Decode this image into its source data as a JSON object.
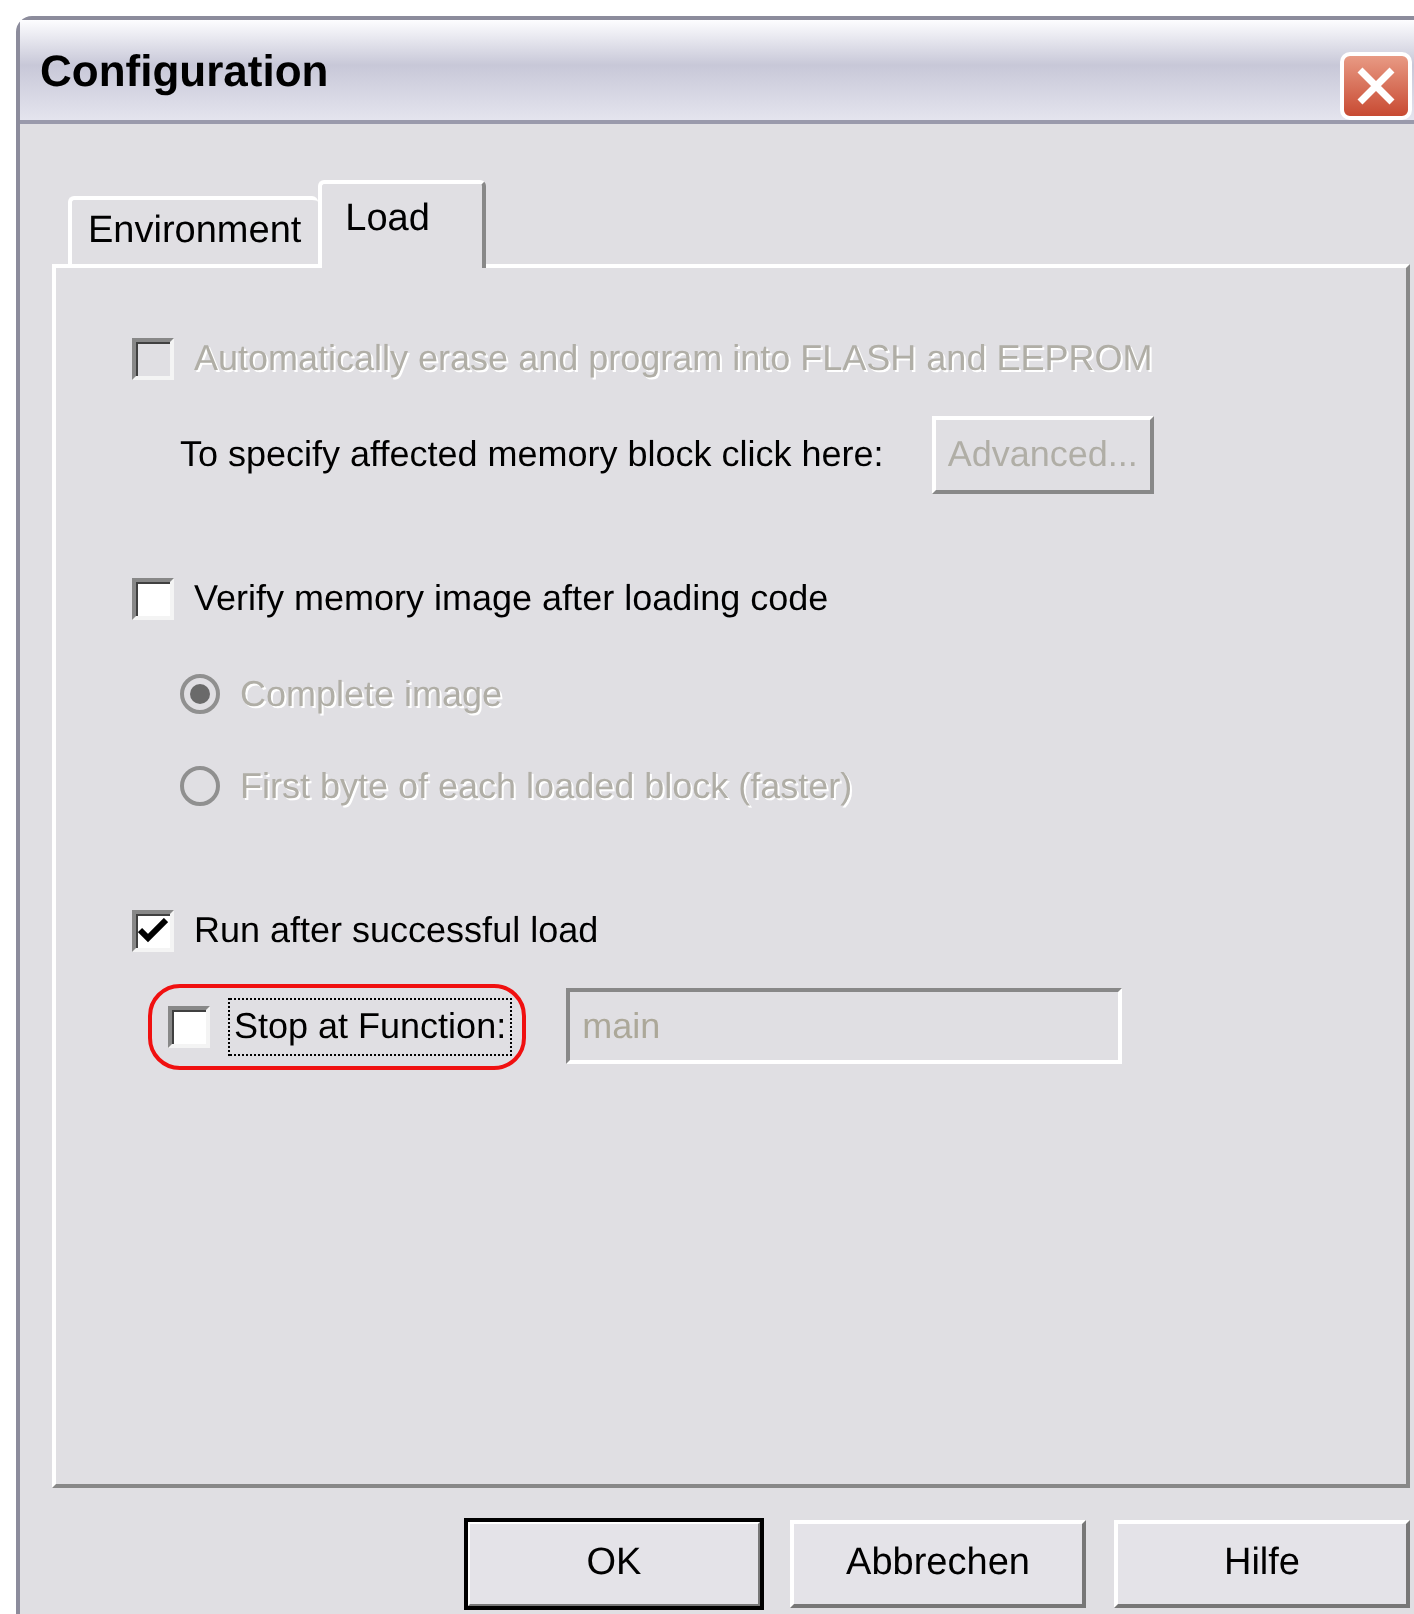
{
  "window": {
    "title": "Configuration"
  },
  "tabs": [
    {
      "label": "Environment",
      "selected": false
    },
    {
      "label": "Load",
      "selected": true
    }
  ],
  "groups": [
    {
      "label": "Automatically erase and program into FLASH and EEPROM",
      "checked": false,
      "disabled": true,
      "children": [
        {
          "kind": "button_row",
          "label": "To specify affected memory block click here:",
          "button": {
            "label": "Advanced...",
            "disabled": true
          }
        }
      ]
    },
    {
      "label": "Verify memory image after loading code",
      "checked": false,
      "disabled": false,
      "children": [
        {
          "kind": "radio",
          "label": "Complete image",
          "selected": true,
          "disabled": true
        },
        {
          "kind": "radio",
          "label": "First byte of each loaded block (faster)",
          "selected": false,
          "disabled": true
        }
      ]
    },
    {
      "label": "Run after successful load",
      "checked": true,
      "disabled": false,
      "children": [
        {
          "kind": "checkbox_field",
          "label": "Stop at Function:",
          "checked": false,
          "focused": true,
          "highlighted": true,
          "field": {
            "value": "main",
            "disabled": true
          }
        }
      ]
    }
  ],
  "buttons": [
    {
      "label": "OK",
      "default": true
    },
    {
      "label": "Abbrechen",
      "default": false
    },
    {
      "label": "Hilfe",
      "default": false
    }
  ]
}
